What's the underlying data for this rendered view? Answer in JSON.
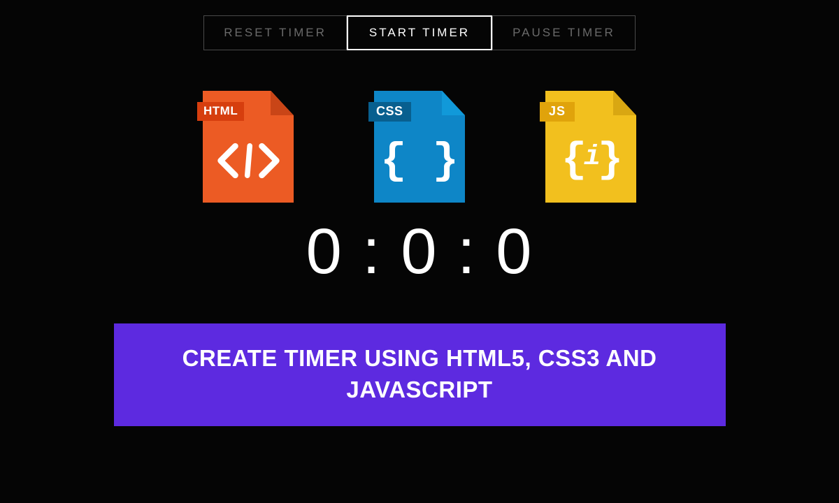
{
  "buttons": {
    "reset": "RESET TIMER",
    "start": "START TIMER",
    "pause": "PAUSE TIMER"
  },
  "icons": {
    "html_badge": "HTML",
    "css_badge": "CSS",
    "js_badge": "JS"
  },
  "timer_display": "0 : 0 : 0",
  "banner_text": "CREATE TIMER USING HTML5, CSS3 AND JAVASCRIPT"
}
